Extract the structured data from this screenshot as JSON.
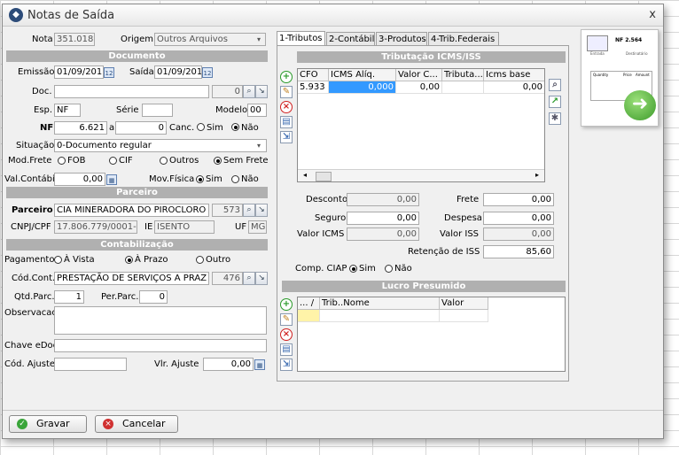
{
  "window": {
    "title": "Notas de Saída",
    "close": "x"
  },
  "left": {
    "nota_label": "Nota",
    "nota_value": "351.018",
    "origem_label": "Origem",
    "origem_value": "Outros Arquivos",
    "documento_section": "Documento",
    "emissao_label": "Emissão",
    "emissao_value": "01/09/201",
    "saida_label": "Saída",
    "saida_value": "01/09/201",
    "doc_label": "Doc.",
    "doc_value": "",
    "doc_num": "0",
    "esp_label": "Esp.",
    "esp_value": "NF",
    "serie_label": "Série",
    "serie_value": "",
    "modelo_label": "Modelo",
    "modelo_value": "00",
    "nf_label": "NF",
    "nf_value": "6.621",
    "a_label": "a",
    "nf_to_value": "0",
    "canc_label": "Canc.",
    "sim_label": "Sim",
    "nao_label": "Não",
    "situacao_label": "Situação",
    "situacao_value": "0-Documento regular",
    "modfrete_label": "Mod.Frete",
    "fob_label": "FOB",
    "cif_label": "CIF",
    "outros_label": "Outros",
    "semfrete_label": "Sem Frete",
    "valcontabil_label": "Val.Contábil",
    "valcontabil_value": "0,00",
    "movfisica_label": "Mov.Física",
    "parceiro_section": "Parceiro",
    "parceiro_label": "Parceiro",
    "parceiro_value": "CIA MINERADORA DO PIROCLORO I",
    "parceiro_code": "573",
    "cnpj_label": "CNPJ/CPF",
    "cnpj_value": "17.806.779/0001-",
    "ie_label": "IE",
    "ie_value": "ISENTO",
    "uf_label": "UF",
    "uf_value": "MG",
    "contab_section": "Contabilização",
    "pagamento_label": "Pagamento",
    "avista_label": "À Vista",
    "aprazo_label": "À Prazo",
    "outro_label": "Outro",
    "codcont_label": "Cód.Cont.",
    "codcont_value": "PRESTAÇÃO DE SERVIÇOS A PRAZ",
    "codcont_code": "476",
    "qtdparc_label": "Qtd.Parc.",
    "qtdparc_value": "1",
    "perparc_label": "Per.Parc.",
    "perparc_value": "0",
    "obs_label": "Observacao",
    "obs_value": "",
    "chave_label": "Chave eDoc",
    "chave_value": "",
    "codajuste_label": "Cód. Ajuste",
    "codajuste_value": "",
    "vlrajuste_label": "Vlr. Ajuste",
    "vlrajuste_value": "0,00"
  },
  "tabs": [
    {
      "label": "1-Tributos"
    },
    {
      "label": "2-Contábil"
    },
    {
      "label": "3-Produtos"
    },
    {
      "label": "4-Trib.Federais"
    }
  ],
  "tributos": {
    "section": "Tributação ICMS/ISS",
    "columns": [
      "CFO",
      "ICMS Alíq.",
      "Valor C...",
      "Tributa...",
      "Icms base"
    ],
    "row": [
      "5.933",
      "0,000",
      "0,00",
      "",
      "0,00"
    ],
    "desconto_label": "Desconto",
    "desconto_value": "0,00",
    "frete_label": "Frete",
    "frete_value": "0,00",
    "seguro_label": "Seguro",
    "seguro_value": "0,00",
    "despesa_label": "Despesa",
    "despesa_value": "0,00",
    "valoricms_label": "Valor ICMS",
    "valoricms_value": "0,00",
    "valoriss_label": "Valor ISS",
    "valoriss_value": "0,00",
    "retencao_label": "Retenção de ISS",
    "retencao_value": "85,60",
    "ciap_label": "Comp. CIAP",
    "ciap_sim": "Sim",
    "ciap_nao": "Não",
    "lucro_section": "Lucro Presumido",
    "lucro_columns": [
      "... /",
      "Trib..Nome",
      "Valor"
    ]
  },
  "thumb": {
    "title": "NF 2.564",
    "left": "Entrada",
    "right": "Destinatário",
    "c1": "Quantity",
    "c2": "Price",
    "c3": "Amount"
  },
  "buttons": {
    "gravar": "Gravar",
    "cancelar": "Cancelar"
  },
  "colors": {
    "accent": "#3399ff",
    "section": "#b0b0b0",
    "selected_cell": "#3399ff"
  }
}
